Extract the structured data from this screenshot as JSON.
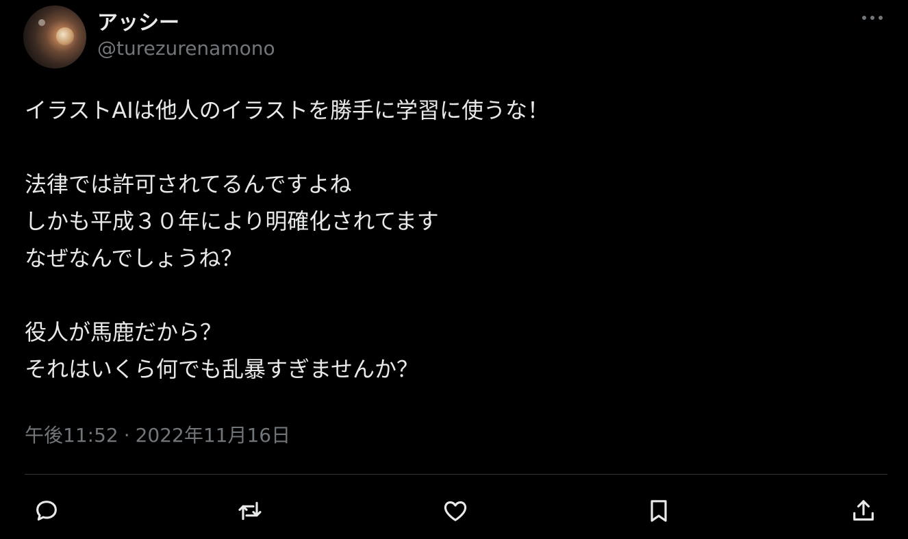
{
  "tweet": {
    "display_name": "アッシー",
    "handle": "@turezurenamono",
    "more_icon": "more-horizontal-icon",
    "lines": [
      "イラストAIは他人のイラストを勝手に学習に使うな！",
      "",
      "法律では許可されてるんですよね",
      "しかも平成３０年により明確化されてます",
      "なぜなんでしょうね？",
      "",
      "役人が馬鹿だから？",
      "それはいくら何でも乱暴すぎませんか？"
    ],
    "time": "午後11:52",
    "separator": "·",
    "date": "2022年11月16日"
  },
  "actions": [
    {
      "name": "reply",
      "icon": "reply-icon"
    },
    {
      "name": "retweet",
      "icon": "retweet-icon"
    },
    {
      "name": "like",
      "icon": "heart-icon"
    },
    {
      "name": "bookmark",
      "icon": "bookmark-icon"
    },
    {
      "name": "share",
      "icon": "share-icon"
    }
  ],
  "colors": {
    "background": "#000000",
    "text": "#e7e9ea",
    "secondary": "#71767b",
    "divider": "#2f3336"
  }
}
